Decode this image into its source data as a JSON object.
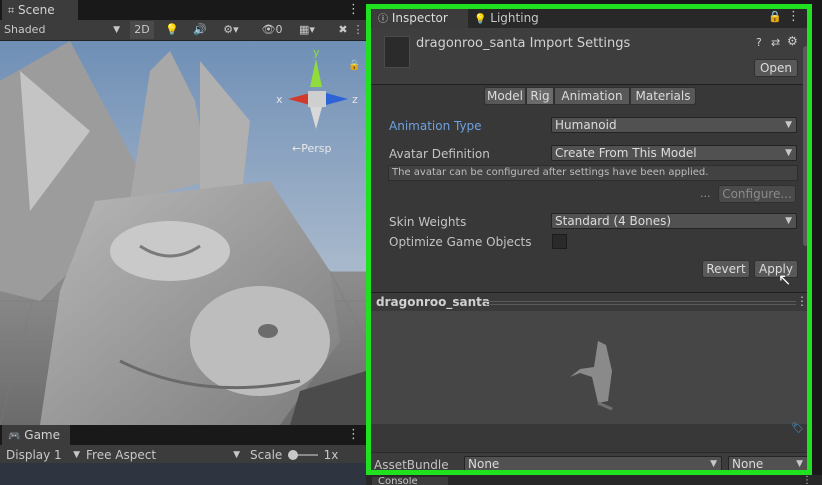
{
  "scene": {
    "tab_label": "Scene",
    "shading_mode": "Shaded",
    "mode_2d": "2D",
    "hidden_count": "0",
    "persp_label": "←Persp",
    "gizmo": {
      "x": "x",
      "y": "y",
      "z": "z"
    }
  },
  "game": {
    "tab_label": "Game",
    "display": "Display 1",
    "aspect": "Free Aspect",
    "scale_label": "Scale",
    "scale_value": "1x"
  },
  "inspector": {
    "tab_label": "Inspector",
    "lighting_tab_label": "Lighting",
    "title": "dragonroo_santa Import Settings",
    "open_button": "Open",
    "tabs": [
      "Model",
      "Rig",
      "Animation",
      "Materials"
    ],
    "active_tab": "Rig",
    "animation_type_label": "Animation Type",
    "animation_type_value": "Humanoid",
    "avatar_definition_label": "Avatar Definition",
    "avatar_definition_value": "Create From This Model",
    "info_text": "The avatar can be configured after settings have been applied.",
    "ellipsis": "...",
    "configure_button": "Configure...",
    "skin_weights_label": "Skin Weights",
    "skin_weights_value": "Standard (4 Bones)",
    "optimize_label": "Optimize Game Objects",
    "revert_button": "Revert",
    "apply_button": "Apply",
    "preview_title": "dragonroo_santa",
    "assetbundle_label": "AssetBundle",
    "assetbundle_value": "None",
    "assetbundle_variant": "None"
  },
  "bottom_tab_label": "Console",
  "colors": {
    "highlight": "#1fe11f",
    "link_label": "#6ea0e0",
    "panel": "#383838"
  }
}
